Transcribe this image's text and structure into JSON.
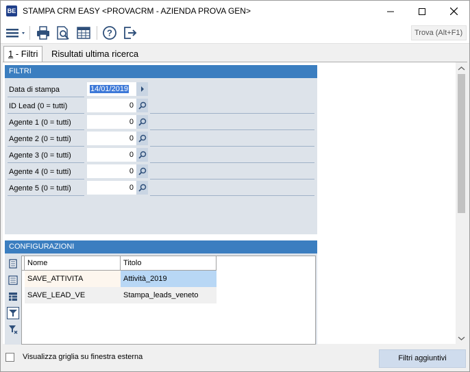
{
  "window": {
    "app_icon_text": "BE",
    "title": "STAMPA CRM EASY <PROVACRM - AZIENDA PROVA GEN>",
    "controls": [
      "minimize-icon",
      "maximize-icon",
      "close-icon"
    ]
  },
  "toolbar": {
    "icons": [
      "menu-icon",
      "print-icon",
      "print-preview-icon",
      "grid-icon",
      "help-icon",
      "exit-icon"
    ],
    "search_label": "Trova (Alt+F1)"
  },
  "tabs": [
    {
      "label_key": "1",
      "label_rest": " - Filtri",
      "active": true
    },
    {
      "label": "Risultati ultima ricerca",
      "active": false
    }
  ],
  "filtri": {
    "header": "FILTRI",
    "date_label": "Data di stampa",
    "date_value": "14/01/2019",
    "rows": [
      {
        "label": "ID Lead (0 = tutti)",
        "value": "0"
      },
      {
        "label": "Agente 1 (0 = tutti)",
        "value": "0"
      },
      {
        "label": "Agente 2 (0 = tutti)",
        "value": "0"
      },
      {
        "label": "Agente 3 (0 = tutti)",
        "value": "0"
      },
      {
        "label": "Agente 4 (0 = tutti)",
        "value": "0"
      },
      {
        "label": "Agente 5 (0 = tutti)",
        "value": "0"
      }
    ]
  },
  "configurazioni": {
    "header": "CONFIGURAZIONI",
    "columns": [
      "Nome",
      "Titolo"
    ],
    "rows": [
      {
        "nome": "SAVE_ATTIVITA",
        "titolo": "Attività_2019"
      },
      {
        "nome": "SAVE_LEAD_VE",
        "titolo": "Stampa_leads_veneto"
      }
    ]
  },
  "footer": {
    "checkbox_label": "Visualizza griglia su finestra esterna",
    "checkbox_checked": false,
    "button_label": "Filtri aggiuntivi"
  },
  "colors": {
    "section_header": "#3b7ec0",
    "section_bg": "#dde3ea",
    "selected_cell": "#b8d7f5",
    "button_bg": "#cfdced"
  }
}
